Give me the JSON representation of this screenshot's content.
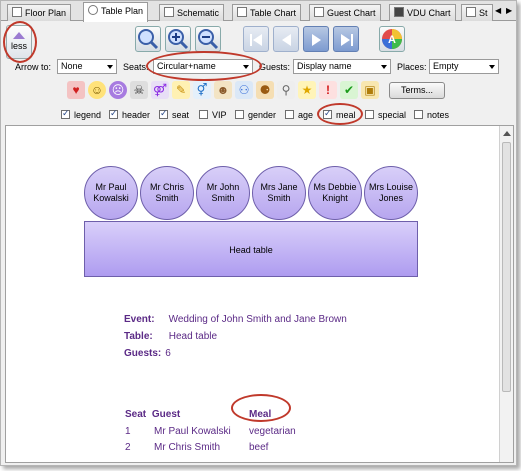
{
  "tabs": [
    {
      "label": "Floor Plan",
      "active": false
    },
    {
      "label": "Table Plan",
      "active": true
    },
    {
      "label": "Schematic",
      "active": false
    },
    {
      "label": "Table Chart",
      "active": false
    },
    {
      "label": "Guest Chart",
      "active": false
    },
    {
      "label": "VDU Chart",
      "active": false
    },
    {
      "label": "St",
      "active": false
    }
  ],
  "toolbar": {
    "less_label": "less",
    "arrow_to_label": "Arrow to:",
    "arrow_to_value": "None",
    "seats_label": "Seats:",
    "seats_value": "Circular+name",
    "guests_label": "Guests:",
    "guests_value": "Display name",
    "places_label": "Places:",
    "places_value": "Empty",
    "terms_label": "Terms..."
  },
  "checkboxes": [
    {
      "label": "legend",
      "checked": true
    },
    {
      "label": "header",
      "checked": true
    },
    {
      "label": "seat",
      "checked": true
    },
    {
      "label": "VIP",
      "checked": false
    },
    {
      "label": "gender",
      "checked": false
    },
    {
      "label": "age",
      "checked": false
    },
    {
      "label": "meal",
      "checked": true
    },
    {
      "label": "special",
      "checked": false
    },
    {
      "label": "notes",
      "checked": false
    }
  ],
  "plan": {
    "seats": [
      {
        "line1": "Mr Paul",
        "line2": "Kowalski"
      },
      {
        "line1": "Mr Chris",
        "line2": "Smith"
      },
      {
        "line1": "Mr John",
        "line2": "Smith"
      },
      {
        "line1": "Mrs Jane",
        "line2": "Smith"
      },
      {
        "line1": "Ms Debbie",
        "line2": "Knight"
      },
      {
        "line1": "Mrs Louise",
        "line2": "Jones"
      }
    ],
    "table_label": "Head table"
  },
  "legend": {
    "event_label": "Event:",
    "event_value": "Wedding of John Smith and Jane Brown",
    "table_label": "Table:",
    "table_value": "Head table",
    "guests_label": "Guests:",
    "guests_value": "6"
  },
  "guest_list": {
    "headers": {
      "seat": "Seat",
      "guest": "Guest",
      "meal": "Meal"
    },
    "rows": [
      {
        "seat": "1",
        "guest": "Mr Paul Kowalski",
        "meal": "vegetarian"
      },
      {
        "seat": "2",
        "guest": "Mr Chris Smith",
        "meal": "beef"
      }
    ]
  },
  "colors": {
    "accent_purple": "#5b2a86",
    "seat_fill": "#c5b8f4",
    "callout_red": "#c0392b",
    "nav_blue": "#7d9bd0"
  },
  "icons": [
    "zoom-fit-icon",
    "zoom-in-icon",
    "zoom-out-icon",
    "first-icon",
    "previous-icon",
    "next-icon",
    "last-icon",
    "colour-palette-icon"
  ]
}
